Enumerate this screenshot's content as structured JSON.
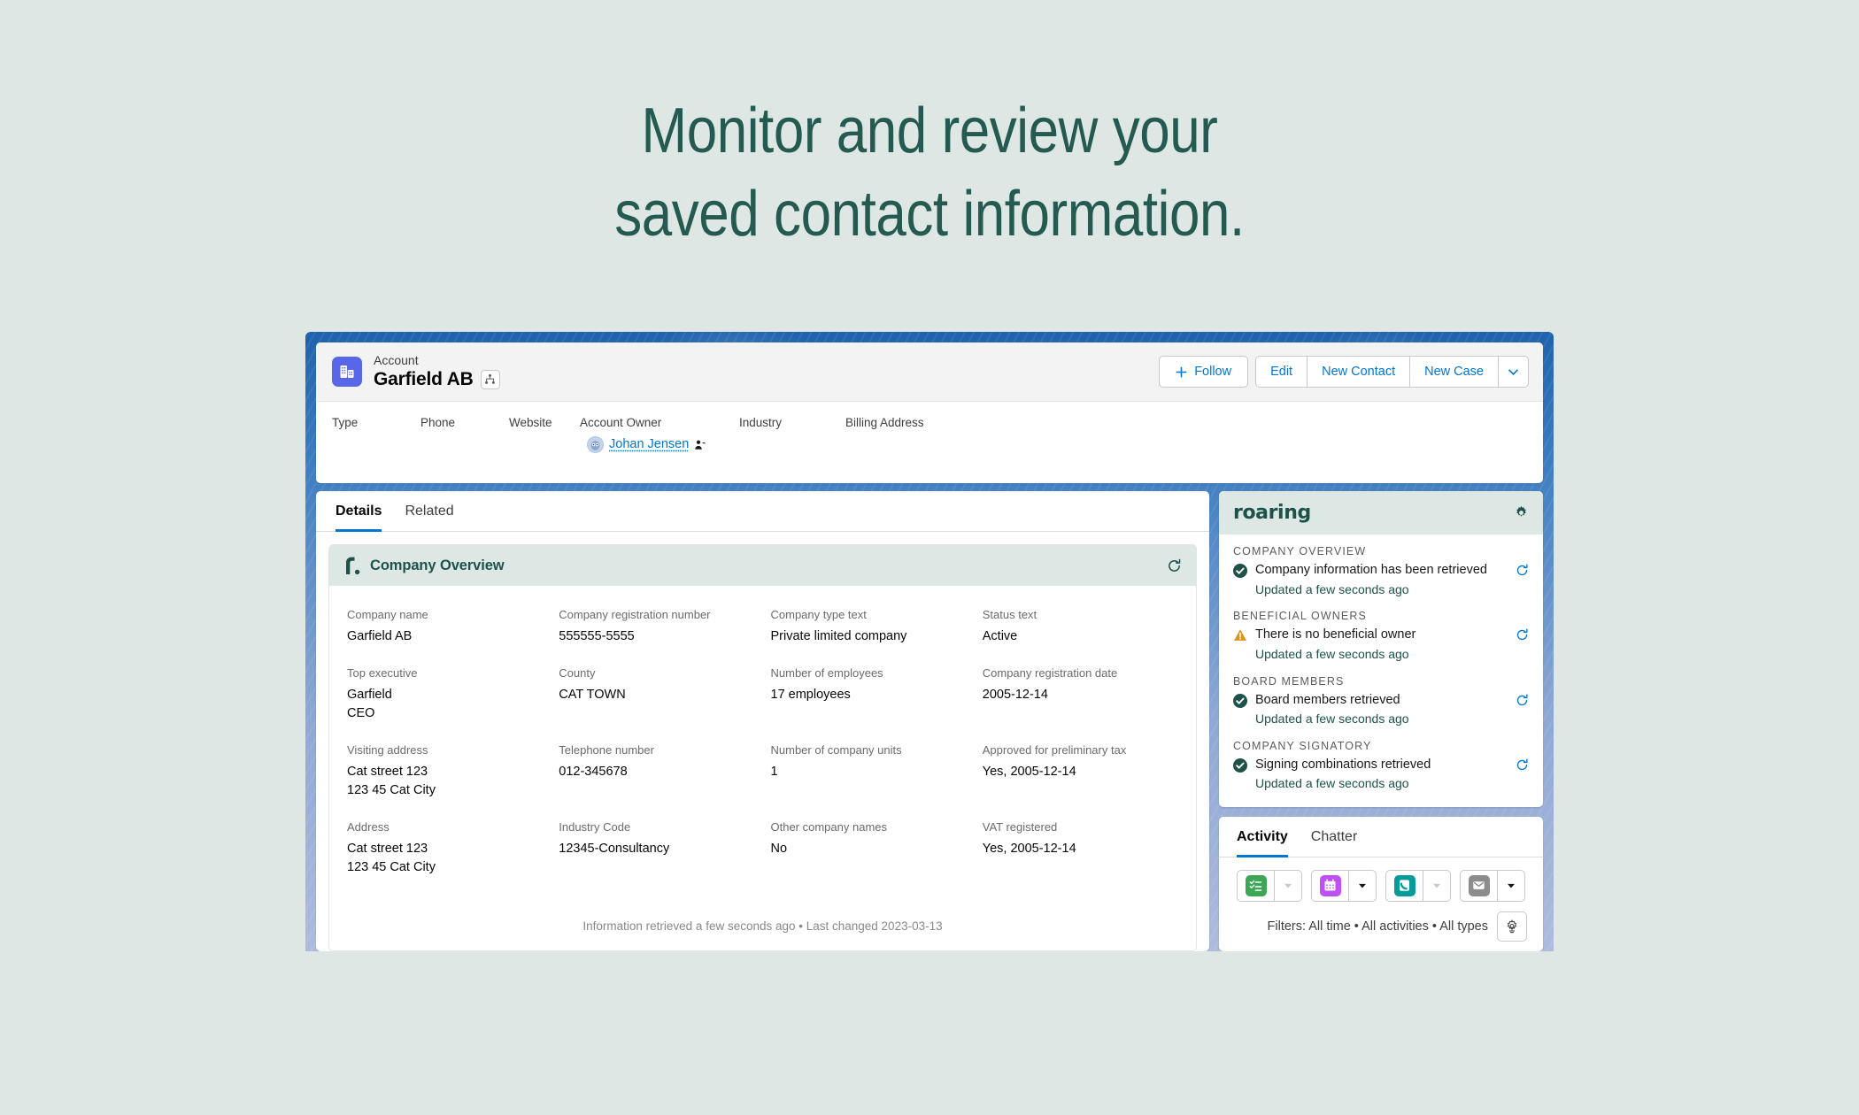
{
  "headline": {
    "line1": "Monitor and review your",
    "line2": "saved contact information."
  },
  "colors": {
    "page_background": "#dfe7e4",
    "headline_text": "#245a4f",
    "frame_blue": "#2a6ab4",
    "salesforce_link": "#0176d3",
    "roaring_green": "#1e5249",
    "roaring_header_bg": "#dde8e4",
    "warning_orange": "#dd9317",
    "account_icon_purple": "#5867e8"
  },
  "record_header": {
    "icon_name": "account-building-icon",
    "eyebrow": "Account",
    "name": "Garfield AB",
    "hierarchy_icon": "account-hierarchy-icon",
    "actions": {
      "follow": "Follow",
      "edit": "Edit",
      "new_contact": "New Contact",
      "new_case": "New Case",
      "more_caret": "▾"
    },
    "fields": [
      {
        "label": "Type",
        "value": ""
      },
      {
        "label": "Phone",
        "value": ""
      },
      {
        "label": "Website",
        "value": ""
      },
      {
        "label": "Account Owner",
        "value": "Johan Jensen",
        "is_link": true
      },
      {
        "label": "Industry",
        "value": ""
      },
      {
        "label": "Billing Address",
        "value": ""
      }
    ]
  },
  "main_panel": {
    "tabs": [
      {
        "label": "Details",
        "active": true
      },
      {
        "label": "Related",
        "active": false
      }
    ],
    "company_overview": {
      "logo_name": "roaring-r-logo-icon",
      "title": "Company Overview",
      "refresh_icon": "refresh-icon",
      "fields": [
        {
          "label": "Company name",
          "value": "Garfield AB"
        },
        {
          "label": "Company registration number",
          "value": "555555-5555"
        },
        {
          "label": "Company type text",
          "value": "Private limited company"
        },
        {
          "label": "Status text",
          "value": "Active"
        },
        {
          "label": "Top executive",
          "value": "Garfield\nCEO"
        },
        {
          "label": "County",
          "value": "CAT TOWN"
        },
        {
          "label": "Number of employees",
          "value": "17 employees"
        },
        {
          "label": "Company registration date",
          "value": "2005-12-14"
        },
        {
          "label": "Visiting address",
          "value": "Cat street 123\n123 45 Cat City"
        },
        {
          "label": "Telephone number",
          "value": "012-345678"
        },
        {
          "label": "Number of company units",
          "value": "1"
        },
        {
          "label": "Approved for preliminary tax",
          "value": "Yes, 2005-12-14"
        },
        {
          "label": "Address",
          "value": "Cat street 123\n123 45 Cat City"
        },
        {
          "label": "Industry Code",
          "value": "12345-Consultancy"
        },
        {
          "label": "Other company names",
          "value": "No"
        },
        {
          "label": "VAT registered",
          "value": "Yes, 2005-12-14"
        }
      ],
      "footer": "Information retrieved a few seconds ago  •  Last changed 2023-03-13"
    }
  },
  "side_panel": {
    "brand": "roaring",
    "settings_icon": "gear-icon",
    "sections": [
      {
        "title": "COMPANY OVERVIEW",
        "status": "success",
        "status_icon": "check-circle-icon",
        "message": "Company information has been retrieved",
        "updated": "Updated a few seconds ago",
        "refresh_icon": "refresh-icon"
      },
      {
        "title": "BENEFICIAL OWNERS",
        "status": "warning",
        "status_icon": "warning-triangle-icon",
        "message": "There is no beneficial owner",
        "updated": "Updated a few seconds ago",
        "refresh_icon": "refresh-icon"
      },
      {
        "title": "BOARD MEMBERS",
        "status": "success",
        "status_icon": "check-circle-icon",
        "message": "Board members retrieved",
        "updated": "Updated a few seconds ago",
        "refresh_icon": "refresh-icon"
      },
      {
        "title": "COMPANY SIGNATORY",
        "status": "success",
        "status_icon": "check-circle-icon",
        "message": "Signing combinations retrieved",
        "updated": "Updated a few seconds ago",
        "refresh_icon": "refresh-icon"
      }
    ]
  },
  "activity_panel": {
    "tabs": [
      {
        "label": "Activity",
        "active": true
      },
      {
        "label": "Chatter",
        "active": false
      }
    ],
    "tools": [
      {
        "name": "new-task",
        "icon": "task-checklist-icon",
        "color": "#3ba755",
        "caret": "▾",
        "caret_enabled": false
      },
      {
        "name": "new-event",
        "icon": "calendar-icon",
        "color": "#c050f5",
        "caret": "▾",
        "caret_enabled": true
      },
      {
        "name": "log-a-call",
        "icon": "phone-icon",
        "color": "#069b9a",
        "caret": "▾",
        "caret_enabled": false
      },
      {
        "name": "send-email",
        "icon": "email-icon",
        "color": "#8c8c8c",
        "caret": "▾",
        "caret_enabled": true
      }
    ],
    "filters_text": "Filters: All time • All activities • All types",
    "filters_gear_icon": "filter-settings-icon"
  }
}
